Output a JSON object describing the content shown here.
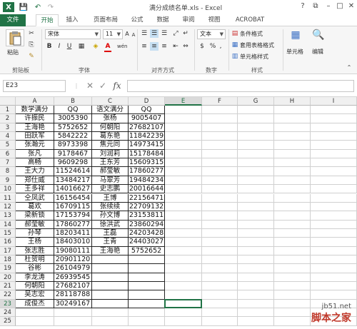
{
  "app": {
    "title": "满分成绩名单.xls - Excel"
  },
  "quick_access": [
    "X",
    "💾",
    "↶",
    "↷"
  ],
  "window_buttons": [
    "?",
    "⧉",
    "–",
    "□",
    "✕"
  ],
  "tabs": [
    {
      "label": "文件"
    },
    {
      "label": "开始"
    },
    {
      "label": "插入"
    },
    {
      "label": "页面布局"
    },
    {
      "label": "公式"
    },
    {
      "label": "数据"
    },
    {
      "label": "审阅"
    },
    {
      "label": "视图"
    },
    {
      "label": "ACROBAT"
    }
  ],
  "ribbon": {
    "clipboard": {
      "paste_label": "粘贴",
      "group_label": "剪贴板"
    },
    "font": {
      "font_name": "宋体",
      "font_size": "11",
      "group_label": "字体"
    },
    "alignment": {
      "group_label": "对齐方式"
    },
    "number": {
      "format": "文本",
      "group_label": "数字"
    },
    "styles": {
      "conditional_format": "条件格式",
      "table_format": "套用表格格式",
      "cell_styles": "单元格样式",
      "group_label": "样式"
    },
    "cells": {
      "label": "单元格"
    },
    "editing": {
      "label": "编辑"
    }
  },
  "formula_bar": {
    "name_box": "E23",
    "fx_label": "fx",
    "value": ""
  },
  "sheet": {
    "columns": [
      "A",
      "B",
      "C",
      "D",
      "E",
      "F",
      "G",
      "H",
      "I"
    ],
    "selected_column": "E",
    "selected_row": "23",
    "rows": [
      [
        "数学满分",
        "QQ",
        "语文满分",
        "QQ"
      ],
      [
        "许振民",
        "3005390",
        "张杨",
        "9005407"
      ],
      [
        "王海艳",
        "5752652",
        "何朝阳",
        "27682107"
      ],
      [
        "田跃军",
        "5842222",
        "葛东艳",
        "11842239"
      ],
      [
        "张瀚元",
        "8973398",
        "焦元同",
        "14973415"
      ],
      [
        "张凡",
        "9178467",
        "刘润莉",
        "15178484"
      ],
      [
        "高畅",
        "9609298",
        "王东芳",
        "15609315"
      ],
      [
        "王大力",
        "11524614",
        "郝莹敏",
        "17860277"
      ],
      [
        "郑仕威",
        "13484217",
        "马翠芳",
        "19484234"
      ],
      [
        "王多祥",
        "14016627",
        "史志鹏",
        "20016644"
      ],
      [
        "仝凤武",
        "16156454",
        "王博",
        "22156471"
      ],
      [
        "葛欢",
        "16709115",
        "张续续",
        "22709132"
      ],
      [
        "梁新锁",
        "17153794",
        "孙文博",
        "23153811"
      ],
      [
        "郝莹敏",
        "17860277",
        "徐洪武",
        "23860294"
      ],
      [
        "孙琴",
        "18203411",
        "王磊",
        "24203428"
      ],
      [
        "王杨",
        "18403010",
        "王青",
        "24403027"
      ],
      [
        "张志胜",
        "19080111",
        "王海艳",
        "5752652"
      ],
      [
        "杜贺明",
        "20901120",
        "",
        ""
      ],
      [
        "谷彬",
        "26104979",
        "",
        ""
      ],
      [
        "李龙涛",
        "26939545",
        "",
        ""
      ],
      [
        "何朝阳",
        "27682107",
        "",
        ""
      ],
      [
        "吴志宏",
        "28118788",
        "",
        ""
      ],
      [
        "成俊杰",
        "30249167",
        "",
        ""
      ]
    ]
  },
  "watermark": {
    "line1": "jb51.net",
    "line2": "脚本之家"
  }
}
